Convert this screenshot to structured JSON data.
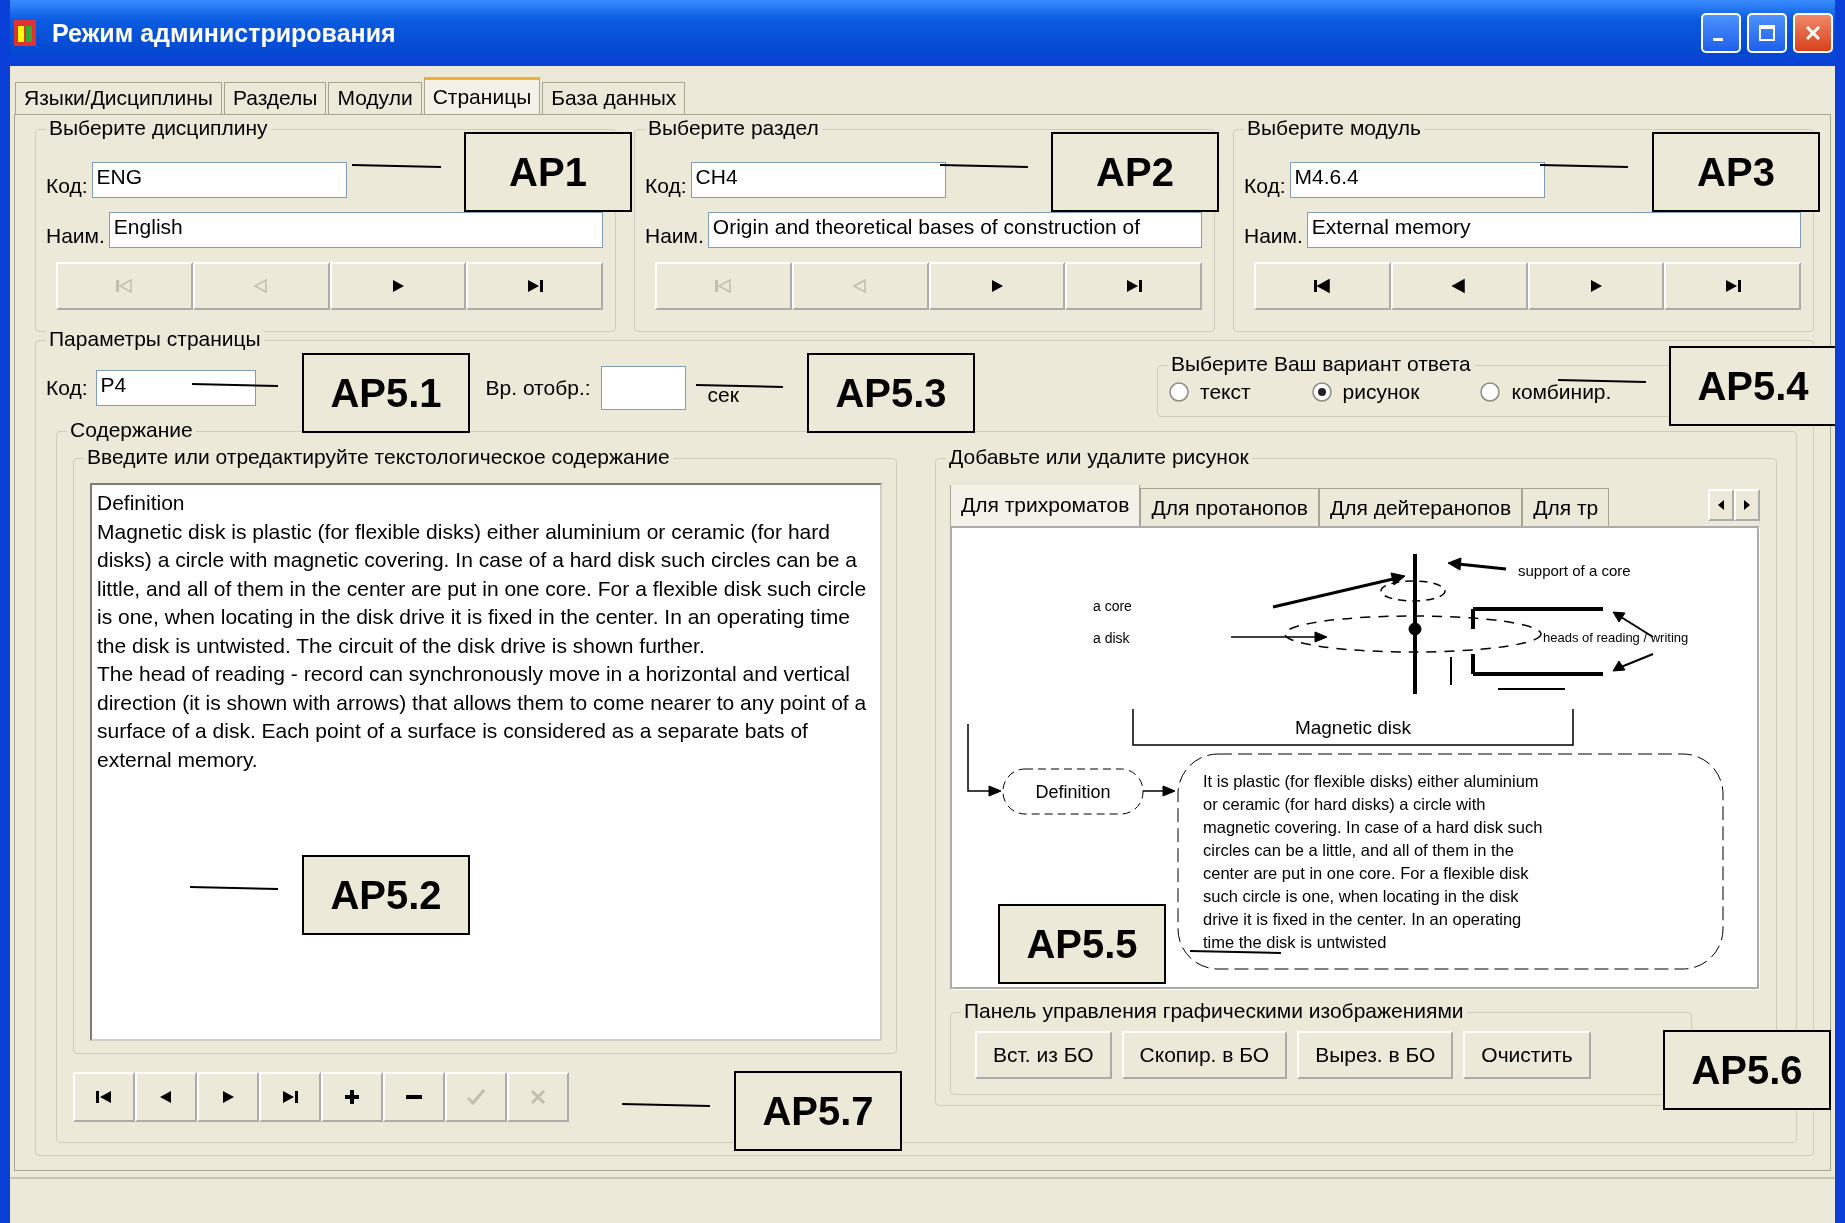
{
  "window": {
    "title": "Режим администрирования"
  },
  "tabs": [
    {
      "label": "Языки/Дисциплины",
      "selected": false
    },
    {
      "label": "Разделы",
      "selected": false
    },
    {
      "label": "Модули",
      "selected": false
    },
    {
      "label": "Страницы",
      "selected": true
    },
    {
      "label": "База данных",
      "selected": false
    }
  ],
  "selectors": [
    {
      "title": "Выберите дисциплину",
      "code_label": "Код:",
      "code": "ENG",
      "name_label": "Наим.",
      "name": "English",
      "nav": [
        {
          "kind": "first",
          "disabled": true
        },
        {
          "kind": "prev",
          "disabled": true
        },
        {
          "kind": "next",
          "disabled": false
        },
        {
          "kind": "last",
          "disabled": false
        }
      ]
    },
    {
      "title": "Выберите раздел",
      "code_label": "Код:",
      "code": "CH4",
      "name_label": "Наим.",
      "name": "Origin and theoretical bases of construction of",
      "nav": [
        {
          "kind": "first",
          "disabled": true
        },
        {
          "kind": "prev",
          "disabled": true
        },
        {
          "kind": "next",
          "disabled": false
        },
        {
          "kind": "last",
          "disabled": false
        }
      ]
    },
    {
      "title": "Выберите модуль",
      "code_label": "Код:",
      "code": "M4.6.4",
      "name_label": "Наим.",
      "name": "External memory",
      "nav": [
        {
          "kind": "first",
          "disabled": false
        },
        {
          "kind": "prev",
          "disabled": false
        },
        {
          "kind": "next",
          "disabled": false
        },
        {
          "kind": "last",
          "disabled": false
        }
      ]
    }
  ],
  "page_params": {
    "title": "Параметры страницы",
    "code_label": "Код:",
    "code": "P4",
    "time_label": "Вр. отобр.:",
    "time_unit": "сек",
    "answer": {
      "title": "Выберите Ваш вариант ответа",
      "options": [
        {
          "label": "текст",
          "selected": false
        },
        {
          "label": "рисунок",
          "selected": true
        },
        {
          "label": "комбинир.",
          "selected": false
        }
      ]
    }
  },
  "content": {
    "title": "Содержание",
    "text_panel": {
      "title": "Введите или отредактируйте текстологическое содержание",
      "paragraphs": [
        "Definition",
        "Magnetic disk is plastic (for flexible disks) either aluminium or ceramic (for hard disks) a circle with magnetic covering. In case of a hard disk such circles can be a little, and all of them in the center are put in one core. For a flexible disk such circle is one, when locating in the disk drive it is fixed in the center. In an operating time the disk is untwisted. The circuit of the disk drive is shown further.",
        "The head of reading - record can synchronously move in a horizontal and vertical direction (it is shown with arrows) that allows them to come nearer to any point of a surface of a disk. Each point of a surface is considered as a separate bats of external memory."
      ]
    },
    "nav": [
      {
        "kind": "first",
        "disabled": false
      },
      {
        "kind": "prev",
        "disabled": false
      },
      {
        "kind": "next",
        "disabled": false
      },
      {
        "kind": "last",
        "disabled": false
      },
      {
        "kind": "plus",
        "disabled": false
      },
      {
        "kind": "minus",
        "disabled": false
      },
      {
        "kind": "check",
        "disabled": true
      },
      {
        "kind": "cross",
        "disabled": true
      }
    ],
    "picture_panel": {
      "title": "Добавьте или удалите рисунок",
      "tabs": [
        {
          "label": "Для трихроматов",
          "selected": true
        },
        {
          "label": "Для протанопов",
          "selected": false
        },
        {
          "label": "Для дейтеранопов",
          "selected": false
        },
        {
          "label": "Для тр",
          "selected": false
        }
      ],
      "diagram": {
        "support_label": "support of a core",
        "core_label": "a core",
        "disk_label": "a disk",
        "heads_label": "heads of reading / writing",
        "title": "Magnetic disk",
        "definition_label": "Definition",
        "definition_lines": [
          "It is plastic (for flexible disks) either aluminium",
          "or ceramic (for hard disks) a circle with",
          "magnetic covering. In case of a hard disk such",
          "circles can be a little, and all of them in the",
          "center are put in one core. For a flexible disk",
          "such circle is one, when locating in the disk",
          "drive it is fixed in the center. In an operating",
          "time the disk is untwisted"
        ]
      },
      "control_panel": {
        "title": "Панель управления графическими изображениями",
        "buttons": [
          "Вст. из БО",
          "Скопир. в БО",
          "Вырез. в БО",
          "Очистить"
        ]
      }
    }
  },
  "annotations": [
    {
      "label": "AP1"
    },
    {
      "label": "AP2"
    },
    {
      "label": "AP3"
    },
    {
      "label": "AP5.1"
    },
    {
      "label": "AP5.3"
    },
    {
      "label": "AP5.4"
    },
    {
      "label": "AP5.2"
    },
    {
      "label": "AP5.5"
    },
    {
      "label": "AP5.6"
    },
    {
      "label": "AP5.7"
    }
  ]
}
